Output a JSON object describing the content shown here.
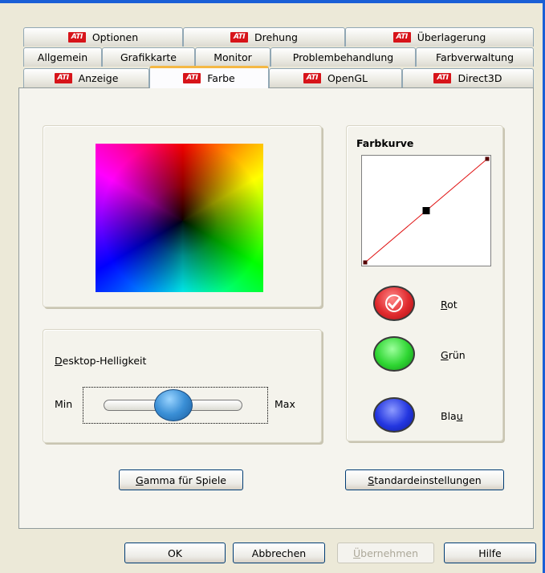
{
  "tabs": {
    "row1": [
      {
        "label": "Optionen",
        "ati": true
      },
      {
        "label": "Drehung",
        "ati": true
      },
      {
        "label": "Überlagerung",
        "ati": true
      }
    ],
    "row2": [
      {
        "label": "Allgemein"
      },
      {
        "label": "Grafikkarte"
      },
      {
        "label": "Monitor"
      },
      {
        "label": "Problembehandlung"
      },
      {
        "label": "Farbverwaltung"
      }
    ],
    "row3": [
      {
        "label": "Anzeige",
        "ati": true
      },
      {
        "label": "Farbe",
        "ati": true,
        "active": true
      },
      {
        "label": "OpenGL",
        "ati": true
      },
      {
        "label": "Direct3D",
        "ati": true
      }
    ]
  },
  "brightness": {
    "title_prefix": "D",
    "title_rest": "esktop-Helligkeit",
    "min_label": "Min",
    "max_label": "Max",
    "value": 0.5
  },
  "curve": {
    "title": "Farbkurve",
    "points": [
      [
        0,
        0
      ],
      [
        0.5,
        0.5
      ],
      [
        1,
        1
      ]
    ]
  },
  "channels": {
    "red": {
      "prefix": "R",
      "rest": "ot",
      "color": "#d9232b"
    },
    "green": {
      "prefix": "G",
      "rest": "rün",
      "color": "#25c12a"
    },
    "blue": {
      "label_start": "Bla",
      "underlined": "u",
      "color": "#1c2fd6"
    }
  },
  "buttons": {
    "gamma": {
      "prefix": "G",
      "rest": "amma für Spiele"
    },
    "defaults": {
      "prefix": "S",
      "rest": "tandardeinstellungen"
    },
    "ok": "OK",
    "cancel": "Abbrechen",
    "apply": {
      "prefix": "Ü",
      "rest": "bernehmen"
    },
    "help": "Hilfe"
  }
}
